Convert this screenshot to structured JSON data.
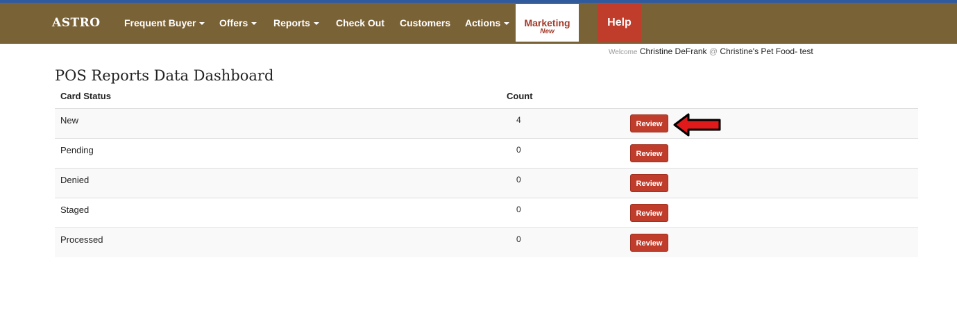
{
  "brand": "ASTRO",
  "nav": {
    "frequent_buyer": "Frequent Buyer",
    "offers": "Offers",
    "reports": "Reports",
    "check_out": "Check Out",
    "customers": "Customers",
    "actions": "Actions",
    "marketing": "Marketing",
    "marketing_badge": "New",
    "help": "Help"
  },
  "welcome": {
    "label": "Welcome",
    "user": "Christine DeFrank",
    "at": "@",
    "store": "Christine's Pet Food- test"
  },
  "page_title": "POS Reports Data Dashboard",
  "table": {
    "headers": {
      "status": "Card Status",
      "count": "Count"
    },
    "rows": [
      {
        "status": "New",
        "count": "4",
        "action": "Review"
      },
      {
        "status": "Pending",
        "count": "0",
        "action": "Review"
      },
      {
        "status": "Denied",
        "count": "0",
        "action": "Review"
      },
      {
        "status": "Staged",
        "count": "0",
        "action": "Review"
      },
      {
        "status": "Processed",
        "count": "0",
        "action": "Review"
      }
    ]
  },
  "annotation": {
    "icon": "red-arrow-left-icon",
    "color": "#e01a1a"
  },
  "colors": {
    "navbar": "#7a6237",
    "accent": "#c03c2b",
    "top_line": "#2f5aa0"
  }
}
